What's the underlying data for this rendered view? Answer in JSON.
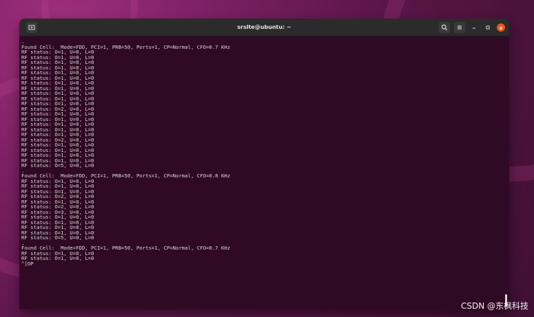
{
  "window": {
    "title": "srslte@ubuntu: ~"
  },
  "terminal": {
    "lines": [
      ".",
      "Found Cell:  Mode=FDD, PCI=1, PRB=50, Ports=1, CP=Normal, CFO=0.7 KHz",
      "RF status: O=1, U=0, L=0",
      "RF status: O=1, U=0, L=0",
      "RF status: O=1, U=0, L=0",
      "RF status: O=1, U=0, L=0",
      "RF status: O=1, U=0, L=0",
      "RF status: O=1, U=0, L=0",
      "RF status: O=1, U=0, L=0",
      "RF status: O=1, U=0, L=0",
      "RF status: O=1, U=0, L=0",
      "RF status: O=1, U=0, L=0",
      "RF status: O=1, U=0, L=0",
      "RF status: O=2, U=0, L=0",
      "RF status: O=1, U=0, L=0",
      "RF status: O=1, U=0, L=0",
      "RF status: O=1, U=0, L=0",
      "RF status: O=1, U=0, L=0",
      "RF status: O=1, U=0, L=0",
      "RF status: O=2, U=0, L=0",
      "RF status: O=1, U=0, L=0",
      "RF status: O=1, U=0, L=0",
      "RF status: O=1, U=0, L=0",
      "RF status: O=1, U=0, L=0",
      "RF status: O=5, U=0, L=0",
      ".",
      "Found Cell:  Mode=FDD, PCI=1, PRB=50, Ports=1, CP=Normal, CFO=0.8 KHz",
      "RF status: O=1, U=0, L=0",
      "RF status: O=1, U=0, L=0",
      "RF status: O=1, U=0, L=0",
      "RF status: O=2, U=0, L=0",
      "RF status: O=1, U=0, L=0",
      "RF status: O=2, U=0, L=0",
      "RF status: O=3, U=0, L=0",
      "RF status: O=1, U=0, L=0",
      "RF status: O=1, U=0, L=0",
      "RF status: O=1, U=0, L=0",
      "RF status: O=1, U=0, L=0",
      "RF status: O=5, U=0, L=0",
      ".",
      "Found Cell:  Mode=FDD, PCI=1, PRB=50, Ports=1, CP=Normal, CFO=0.7 KHz",
      "RF status: O=1, U=0, L=0",
      "RF status: O=1, U=0, L=0",
      "^[OP"
    ]
  },
  "watermark": "CSDN @东枫科技",
  "icons": {
    "new_tab": "new-tab-icon",
    "search": "search-icon",
    "menu": "hamburger-menu-icon",
    "minimize": "minimize-icon",
    "maximize": "maximize-icon",
    "close": "close-icon"
  },
  "colors": {
    "terminal_bg": "#300a24",
    "terminal_text": "#d9d9d9",
    "titlebar_bg": "#2b2b2b",
    "close_button": "#e95420",
    "desktop_bg": "#5b1648"
  }
}
